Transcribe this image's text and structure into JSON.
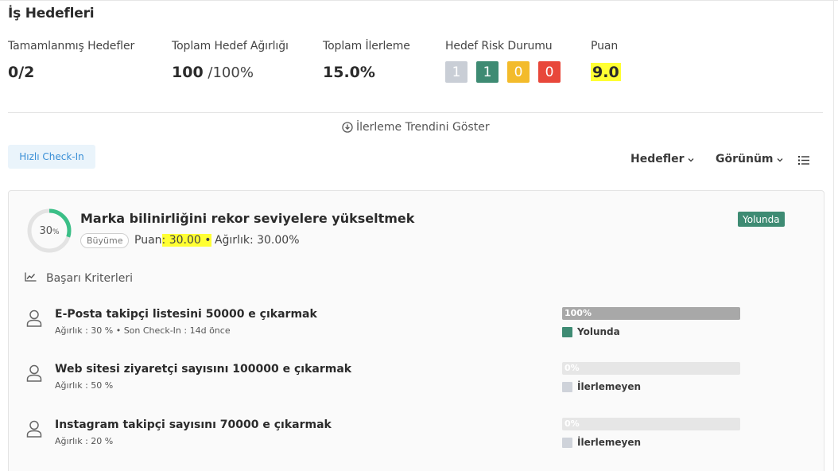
{
  "page": {
    "title": "İş Hedefleri"
  },
  "stats": {
    "completed": {
      "label": "Tamamlanmış Hedefler",
      "value": "0/2"
    },
    "weight": {
      "label": "Toplam Hedef Ağırlığı",
      "value": "100",
      "unit": " /100%"
    },
    "progress": {
      "label": "Toplam İlerleme",
      "value": "15.0%"
    },
    "risk": {
      "label": "Hedef Risk Durumu",
      "boxes": [
        {
          "value": "1",
          "color": "#c9ced6"
        },
        {
          "value": "1",
          "color": "#3e8b73"
        },
        {
          "value": "0",
          "color": "#f3bb2b"
        },
        {
          "value": "0",
          "color": "#e8473a"
        }
      ]
    },
    "score": {
      "label": "Puan",
      "value": "9.0"
    }
  },
  "trend_toggle": {
    "label": "İlerleme Trendini Göster",
    "icon": "download-circle-icon"
  },
  "toolbar": {
    "quick_checkin": "Hızlı Check-In",
    "goals_dropdown": "Hedefler",
    "view_dropdown": "Görünüm",
    "list_icon": "list-icon"
  },
  "goal": {
    "progress_percent": 30,
    "progress_label": "30",
    "progress_unit": "%",
    "title": "Marka bilinirliğini rekor seviyelere yükseltmek",
    "tag": "Büyüme",
    "score_prefix": "Puan",
    "score_highlight": ": 30.00 •",
    "weight_text": " Ağırlık: 30.00%",
    "status": "Yolunda",
    "status_color": "#3e8b73",
    "ring_color": "#3bbf87"
  },
  "criteria": {
    "header": "Başarı Kriterleri",
    "items": [
      {
        "title": "E-Posta takipçi listesini 50000 e çıkarmak",
        "subtitle": "Ağırlık : 30 %   •   Son Check-In : 14d önce",
        "progress": 100,
        "progress_label": "100%",
        "status": "Yolunda",
        "status_color": "#3e8b73"
      },
      {
        "title": "Web sitesi ziyaretçi sayısını 100000 e çıkarmak",
        "subtitle": "Ağırlık : 50 %",
        "progress": 0,
        "progress_label": "0%",
        "status": "İlerlemeyen",
        "status_color": "#cfd3da"
      },
      {
        "title": "Instagram takipçi sayısını 70000 e çıkarmak",
        "subtitle": "Ağırlık : 20 %",
        "progress": 0,
        "progress_label": "0%",
        "status": "İlerlemeyen",
        "status_color": "#cfd3da"
      }
    ]
  }
}
